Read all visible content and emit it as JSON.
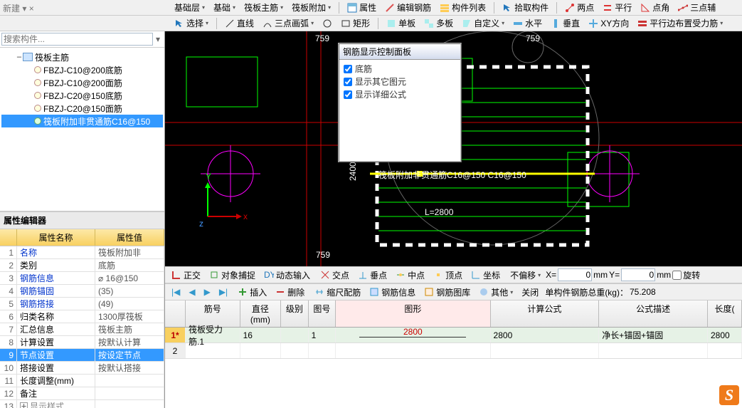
{
  "top_toolbar1": {
    "items": [
      "基础层",
      "基础",
      "筏板主筋",
      "筏板附加"
    ],
    "btns": [
      "属性",
      "编辑钢筋",
      "构件列表",
      "拾取构件",
      "两点",
      "平行",
      "点角",
      "三点辅"
    ]
  },
  "top_toolbar2": {
    "select": "选择",
    "line": "直线",
    "arc": "三点画弧",
    "rect": "矩形",
    "single": "单板",
    "multi": "多板",
    "custom": "自定义",
    "horiz": "水平",
    "vert": "垂直",
    "xy": "XY方向",
    "parallel": "平行边布置受力筋"
  },
  "search": {
    "placeholder": "搜索构件..."
  },
  "tree": {
    "root": "筏板主筋",
    "items": [
      "FBZJ-C10@200底筋",
      "FBZJ-C10@200面筋",
      "FBZJ-C20@150底筋",
      "FBZJ-C20@150面筋",
      "筏板附加非贯通筋C16@150"
    ]
  },
  "props": {
    "title": "属性编辑器",
    "head_name": "属性名称",
    "head_val": "属性值",
    "rows": [
      {
        "n": "1",
        "name": "名称",
        "val": "筏板附加非",
        "blue": true
      },
      {
        "n": "2",
        "name": "类别",
        "val": "底筋"
      },
      {
        "n": "3",
        "name": "钢筋信息",
        "val": "⌀ 16@150",
        "blue": true
      },
      {
        "n": "4",
        "name": "钢筋锚固",
        "val": "(35)",
        "blue": true
      },
      {
        "n": "5",
        "name": "钢筋搭接",
        "val": "(49)",
        "blue": true
      },
      {
        "n": "6",
        "name": "归类名称",
        "val": "1300厚筏板"
      },
      {
        "n": "7",
        "name": "汇总信息",
        "val": "筏板主筋"
      },
      {
        "n": "8",
        "name": "计算设置",
        "val": "按默认计算"
      },
      {
        "n": "9",
        "name": "节点设置",
        "val": "按设定节点",
        "sel": true
      },
      {
        "n": "10",
        "name": "搭接设置",
        "val": "按默认搭接"
      },
      {
        "n": "11",
        "name": "长度调整(mm)",
        "val": ""
      },
      {
        "n": "12",
        "name": "备注",
        "val": ""
      },
      {
        "n": "13",
        "name": "显示样式",
        "val": "",
        "grey": true,
        "exp": "+"
      }
    ]
  },
  "ctrl_panel": {
    "title": "钢筋显示控制面板",
    "opts": [
      "底筋",
      "显示其它图元",
      "显示详细公式"
    ]
  },
  "canvas_labels": {
    "top1": "759",
    "top2": "759",
    "bot": "759",
    "v": "2400",
    "rebar": "筏板附加非贯通筋C16@150 C16@150",
    "len": "L=2800",
    "axisY": "Y",
    "axisX": "x",
    "axisZ": "z"
  },
  "bottom_bar1": {
    "b1": "正交",
    "b2": "对象捕捉",
    "b3": "动态输入",
    "b4": "交点",
    "b5": "垂点",
    "b6": "中点",
    "b7": "顶点",
    "b8": "坐标",
    "b9": "不偏移",
    "x": "X=",
    "xval": "0",
    "xmm": "mm",
    "y": "Y=",
    "yval": "0",
    "ymm": "mm",
    "rot": "旋转"
  },
  "bottom_bar2": {
    "ins": "插入",
    "del": "删除",
    "a": "缩尺配筋",
    "b": "钢筋信息",
    "c": "钢筋图库",
    "d": "其他",
    "close": "关闭",
    "sum_label": "单构件钢筋总重(kg)：",
    "sum_val": "75.208"
  },
  "table": {
    "heads": [
      "",
      "筋号",
      "直径(mm)",
      "级别",
      "图号",
      "图形",
      "计算公式",
      "公式描述",
      "长度("
    ],
    "rows": [
      {
        "rn": "1*",
        "a": "筏板受力筋.1",
        "b": "16",
        "c": "",
        "d": "1",
        "shape": "2800",
        "f": "2800",
        "g": "净长+锚固+锚固",
        "h": "2800"
      }
    ],
    "empty_rn": "2"
  }
}
